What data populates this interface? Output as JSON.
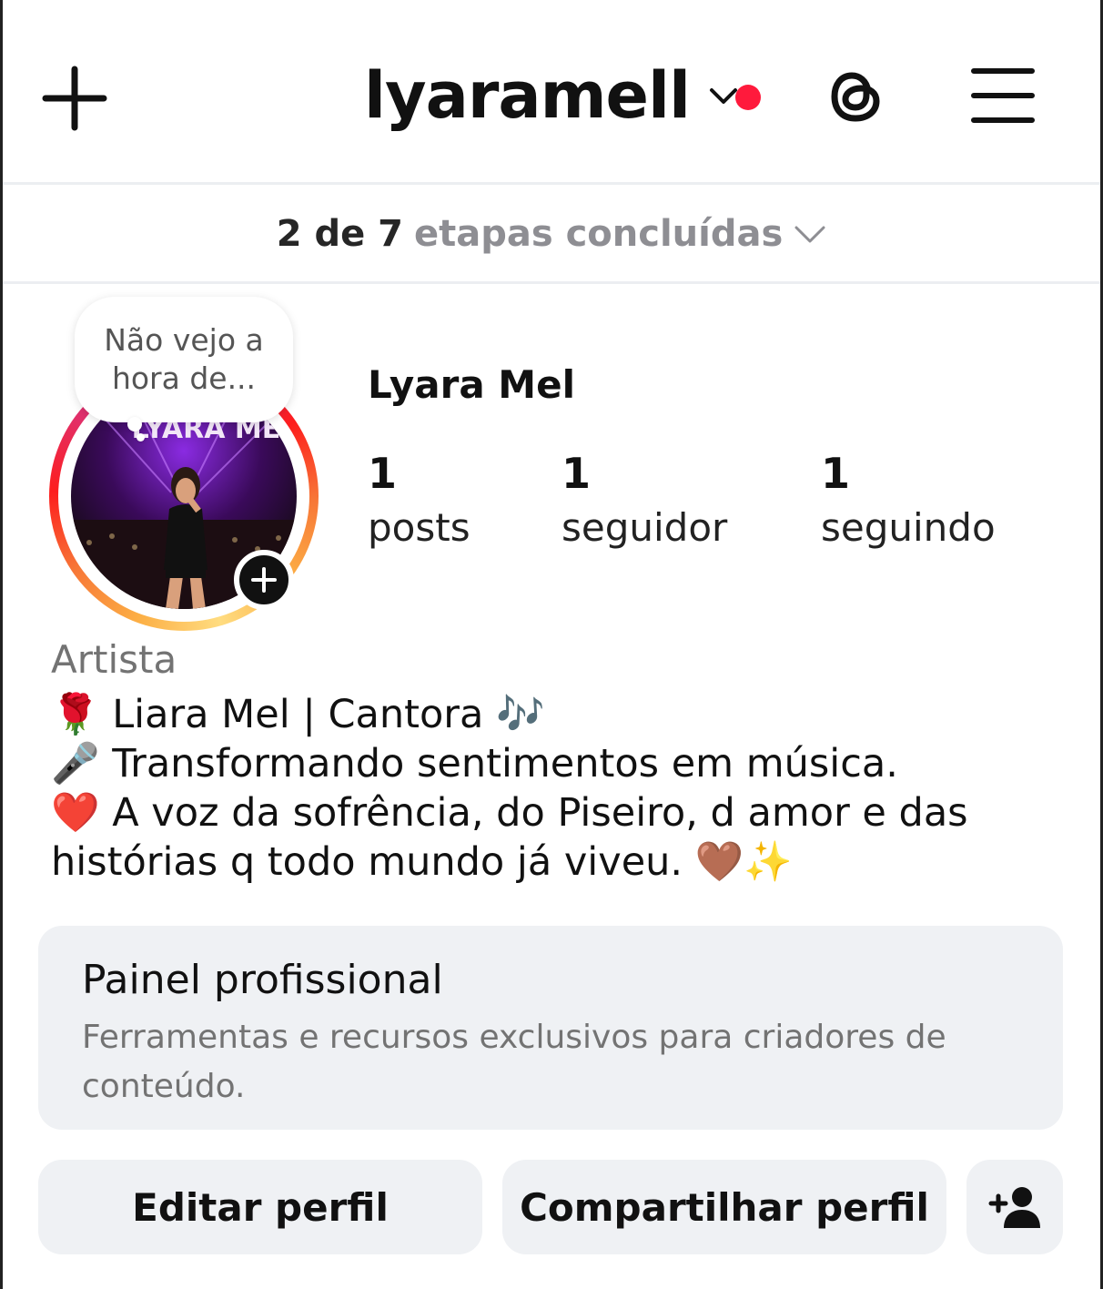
{
  "header": {
    "username": "lyaramell",
    "icons": {
      "create": "plus-icon",
      "account_switch": "chevron-down-icon",
      "threads": "threads-icon",
      "menu": "hamburger-menu-icon"
    },
    "notification_dot_color": "#ff1a3c"
  },
  "onboarding": {
    "progress_strong": "2 de 7",
    "progress_rest": "etapas concluídas",
    "completed_steps": 2,
    "total_steps": 7
  },
  "profile": {
    "note": [
      "Não vejo a",
      "hora de..."
    ],
    "display_name": "Lyara Mel",
    "stats": [
      {
        "value": "1",
        "label": "posts"
      },
      {
        "value": "1",
        "label": "seguidor"
      },
      {
        "value": "1",
        "label": "seguindo"
      }
    ],
    "category": "Artista",
    "bio": "🌹 Liara Mel | Cantora 🎶\n🎤 Transformando sentimentos em música.\n❤️ A voz da sofrência, do Piseiro, d amor e das histórias q todo mundo já viveu. 🤎✨",
    "avatar_text": "LYARA MEL"
  },
  "professional_panel": {
    "title": "Painel profissional",
    "description": "Ferramentas e recursos exclusivos para criadores de conteúdo."
  },
  "actions": {
    "edit_profile": "Editar perfil",
    "share_profile": "Compartilhar perfil",
    "discover_people_icon": "add-person-icon"
  },
  "colors": {
    "button_bg": "#eff1f4",
    "muted_text": "#737373"
  }
}
